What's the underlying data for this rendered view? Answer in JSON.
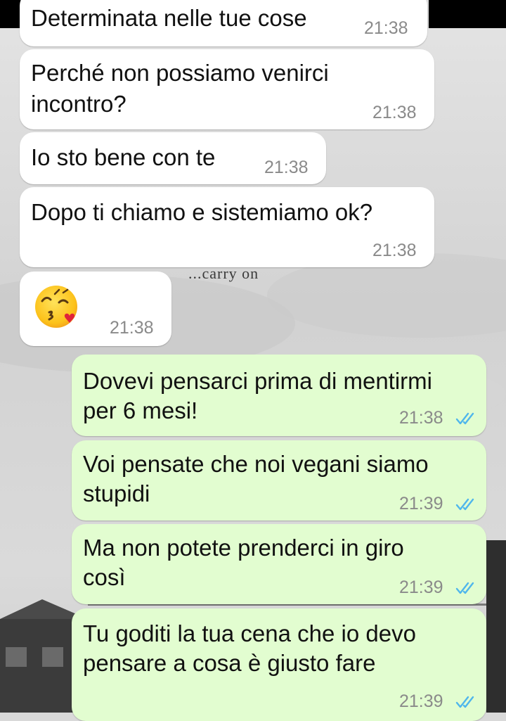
{
  "chat": {
    "wallpaper_caption": "...carry on",
    "messages": [
      {
        "direction": "incoming",
        "lines": [
          "Determinata nelle tue cose"
        ],
        "time": "21:38"
      },
      {
        "direction": "incoming",
        "lines": [
          "Perché non possiamo venirci",
          "incontro?"
        ],
        "time": "21:38"
      },
      {
        "direction": "incoming",
        "lines": [
          "Io sto bene con te"
        ],
        "time": "21:38"
      },
      {
        "direction": "incoming",
        "lines": [
          "Dopo ti chiamo e sistemiamo ok?"
        ],
        "time": "21:38"
      },
      {
        "direction": "incoming",
        "emoji": "face-blowing-a-kiss",
        "time": "21:38"
      },
      {
        "direction": "outgoing",
        "lines": [
          "Dovevi pensarci prima di mentirmi",
          "per 6 mesi!"
        ],
        "time": "21:38",
        "status": "read"
      },
      {
        "direction": "outgoing",
        "lines": [
          "Voi pensate che noi vegani siamo",
          "stupidi"
        ],
        "time": "21:39",
        "status": "read"
      },
      {
        "direction": "outgoing",
        "lines": [
          "Ma non potete prenderci in giro",
          "così"
        ],
        "time": "21:39",
        "status": "read"
      },
      {
        "direction": "outgoing",
        "lines": [
          "Tu goditi la tua cena che io devo",
          "pensare a cosa è giusto fare"
        ],
        "time": "21:39",
        "status": "read"
      }
    ]
  },
  "colors": {
    "incoming_bubble": "#ffffff",
    "outgoing_bubble": "#e2fdd0",
    "read_ticks": "#4fb6ec",
    "timestamp": "#8a8a8a"
  }
}
